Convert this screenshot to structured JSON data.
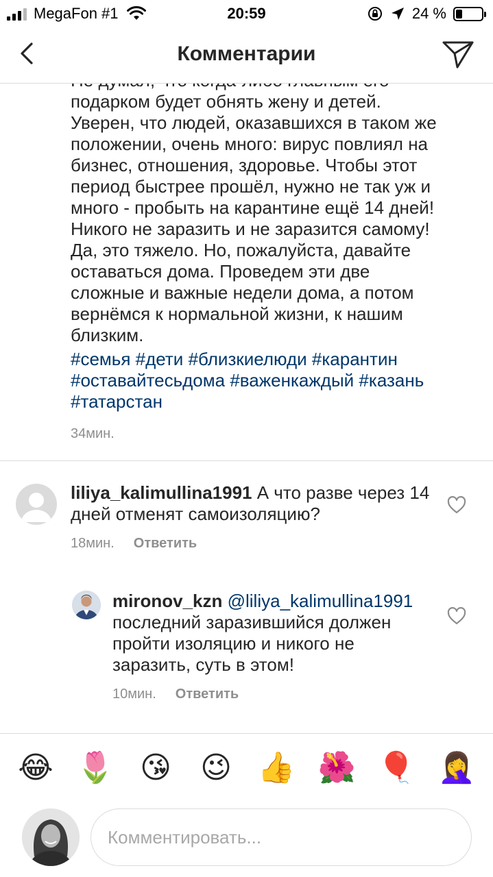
{
  "status_bar": {
    "carrier": "MegaFon #1",
    "time": "20:59",
    "battery_text": "24 %",
    "battery_level": 0.24
  },
  "header": {
    "title": "Комментарии",
    "back_icon": "chevron-left-icon",
    "send_icon": "paper-plane-icon"
  },
  "post": {
    "text": "Не думал, что когда-либо главным его\nподарком будет обнять жену и детей.\nУверен, что людей, оказавшихся в таком же\nположении, очень много:  вирус повлиял на\nбизнес, отношения, здоровье. Чтобы этот\nпериод быстрее прошёл, нужно не так уж и\nмного - пробыть на карантине ещё  14 дней!\nНикого не заразить и не заразится самому!\nДа, это тяжело. Но, пожалуйста, давайте\nоставаться дома. Проведем эти две\nсложные и важные  недели дома, а потом\nвернёмся к нормальной жизни, к нашим\nблизким.",
    "hashtags": [
      "#семья",
      "#дети",
      "#близкиелюди",
      "#карантин",
      "#оставайтесьдома",
      "#важенкаждый",
      "#казань",
      "#татарстан"
    ],
    "time": "34мин."
  },
  "comments": [
    {
      "username": "liliya_kalimullina1991",
      "text": "А что разве через 14 дней отменят самоизоляцию?",
      "time": "18мин.",
      "reply_label": "Ответить"
    },
    {
      "username": "mironov_kzn",
      "mention": "@liliya_kalimullina1991",
      "text": "последний заразившийся должен пройти изоляцию и никого не заразить, суть в этом!",
      "time": "10мин.",
      "reply_label": "Ответить"
    }
  ],
  "emoji_bar": [
    "😂",
    "🌷",
    "😘",
    "😉",
    "👍",
    "🌺",
    "🎈",
    "🤦‍♀️"
  ],
  "composer": {
    "placeholder": "Комментировать..."
  },
  "colors": {
    "link": "#00376b",
    "secondary_text": "#8e8e8e",
    "divider": "#dbdbdb"
  }
}
